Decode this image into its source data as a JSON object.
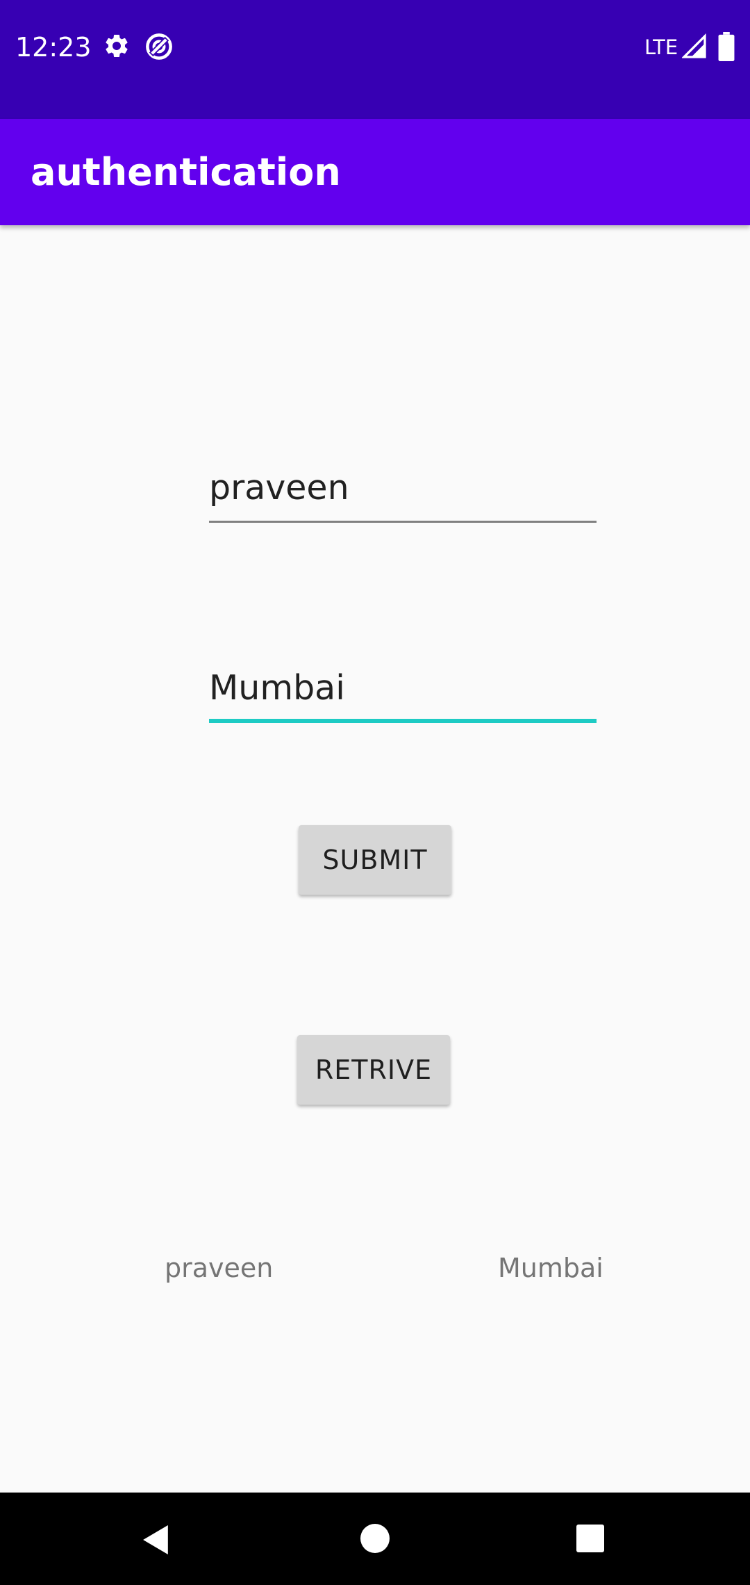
{
  "status_bar": {
    "time": "12:23",
    "network": "LTE",
    "icons": [
      "gear-icon",
      "no-disturb-icon",
      "signal-icon",
      "battery-icon"
    ],
    "background": "#3700b3"
  },
  "app_bar": {
    "title": "authentication",
    "background": "#6200ee"
  },
  "form": {
    "name_field": {
      "value": "praveen"
    },
    "city_field": {
      "value": "Mumbai",
      "focused": true,
      "accent": "#1ecbc4"
    }
  },
  "buttons": {
    "submit_label": "SUBMIT",
    "retrive_label": "RETRIVE"
  },
  "results": {
    "name": "praveen",
    "city": "Mumbai"
  },
  "nav_bar": {
    "icons": [
      "back-icon",
      "home-icon",
      "recents-icon"
    ]
  }
}
